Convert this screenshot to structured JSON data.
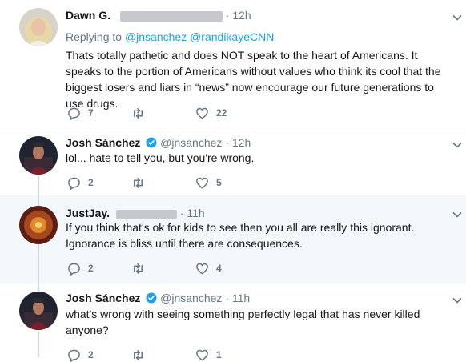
{
  "tweets": [
    {
      "name": "Dawn G.",
      "handle": "",
      "time": "12h",
      "replying_prefix": "Replying to",
      "mentions": [
        "@jnsanchez",
        "@randikayeCNN"
      ],
      "text": "Thats totally pathetic and does NOT speak to the heart of Americans. It speaks to the portion of Americans without values who think its cool that the biggest losers and liars in “news” now encourage our future generations to use drugs.",
      "replies": "7",
      "retweets": "",
      "likes": "22"
    },
    {
      "name": "Josh Sánchez",
      "handle": "@jnsanchez",
      "time": "12h",
      "verified": true,
      "text": "lol... hate to tell you, but you're wrong.",
      "replies": "2",
      "retweets": "",
      "likes": "5"
    },
    {
      "name": "JustJay.",
      "handle": "",
      "time": "11h",
      "text": "If you think that's ok for kids to see then you all are really this ignorant. Ignorance is bliss until there are consequences.",
      "replies": "2",
      "retweets": "",
      "likes": "4"
    },
    {
      "name": "Josh Sánchez",
      "handle": "@jnsanchez",
      "time": "11h",
      "verified": true,
      "text": "what's wrong with seeing something perfectly legal that has never killed anyone?",
      "replies": "2",
      "retweets": "",
      "likes": "1"
    }
  ],
  "separator": "·",
  "icons": {
    "reply": "reply-icon",
    "retweet": "retweet-icon",
    "like": "heart-icon",
    "more": "chevron-down-icon",
    "verified": "verified-badge-icon"
  },
  "colors": {
    "link": "#1da1f2",
    "muted": "#657786",
    "verified": "#1da1f2",
    "alt_background": "#f5f8fa"
  }
}
